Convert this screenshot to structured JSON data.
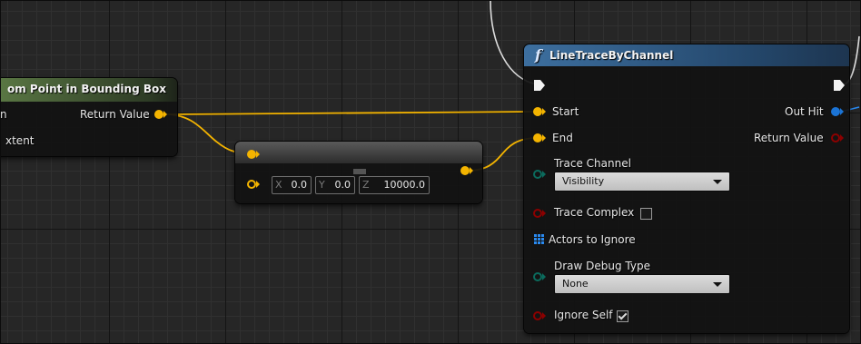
{
  "node_left": {
    "title": "om Point in Bounding Box",
    "pins": [
      {
        "label": "n",
        "type": "input"
      },
      {
        "label": "Return Value",
        "type": "output",
        "color": "#f4b400"
      },
      {
        "label": "xtent",
        "type": "input"
      }
    ]
  },
  "node_vector": {
    "x_axis": "X",
    "x_value": "0.0",
    "y_axis": "Y",
    "y_value": "0.0",
    "z_axis": "Z",
    "z_value": "10000.0"
  },
  "node_trace": {
    "icon": "function-icon",
    "icon_glyph": "f",
    "title": "LineTraceByChannel",
    "inputs": {
      "start": "Start",
      "end": "End",
      "trace_channel": "Trace Channel",
      "trace_complex": "Trace Complex",
      "actors_to_ignore": "Actors to Ignore",
      "draw_debug_type": "Draw Debug Type",
      "ignore_self": "Ignore Self"
    },
    "trace_channel_value": "Visibility",
    "draw_debug_value": "None",
    "trace_complex_checked": false,
    "ignore_self_checked": true,
    "outputs": {
      "out_hit": "Out Hit",
      "return_value": "Return Value"
    }
  },
  "colors": {
    "vector_pin": "#f4b400",
    "struct_pin": "#0a7bd6",
    "bool_pin": "#8c0000",
    "byte_pin": "#0b6b5d",
    "object_pin": "#1b74d6",
    "header_blue": "#2b5b8a",
    "header_green": "#4d6a3b"
  }
}
